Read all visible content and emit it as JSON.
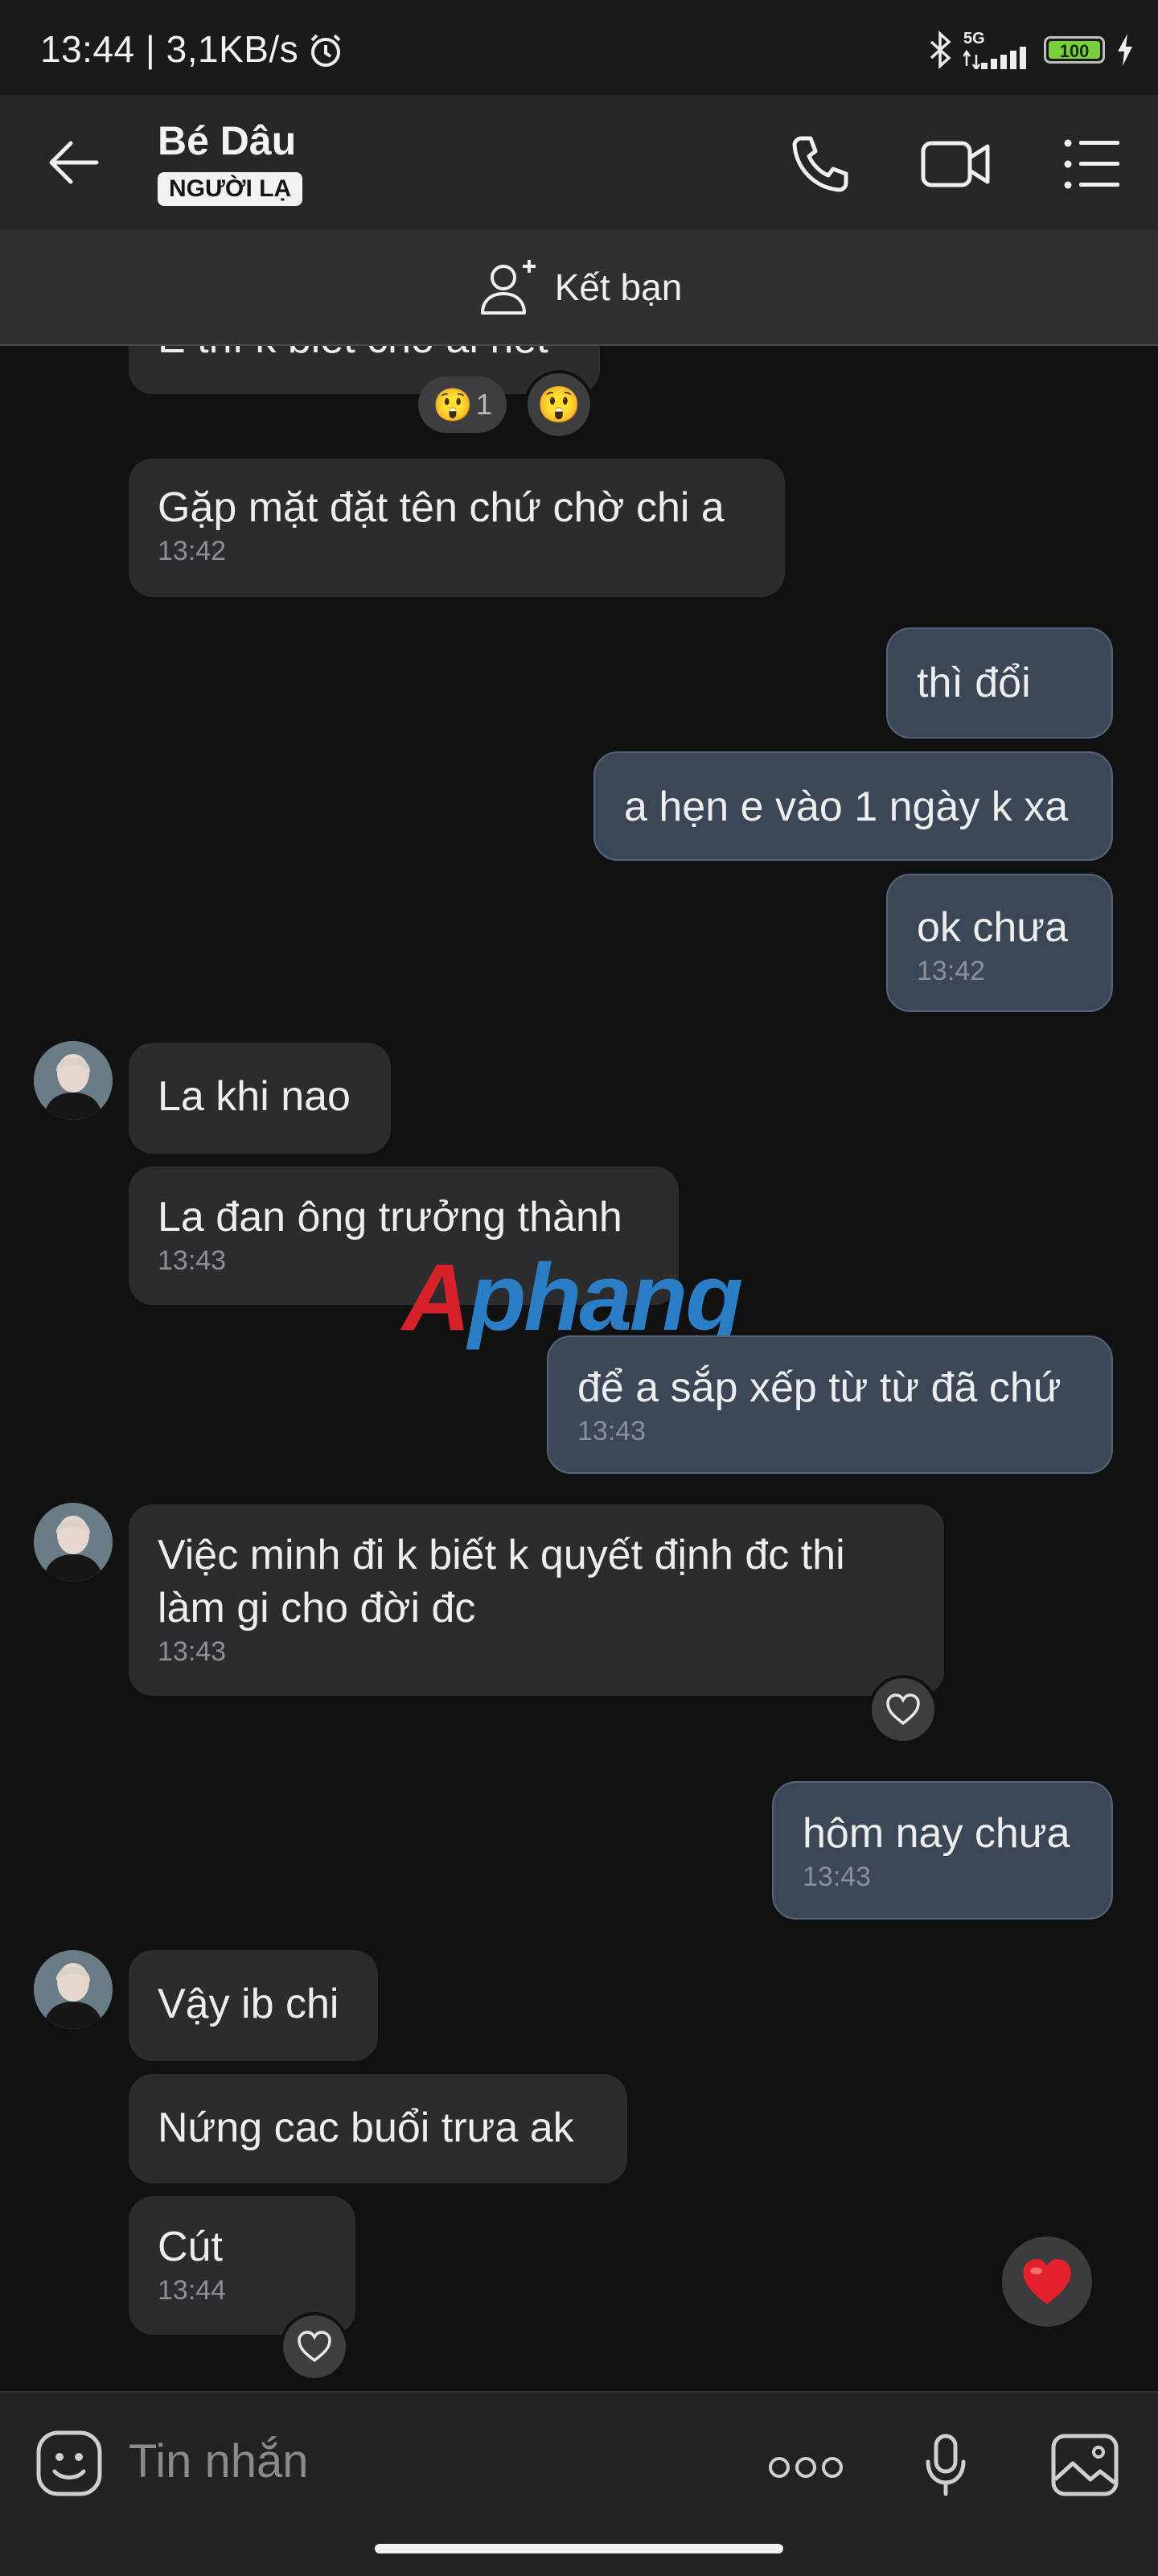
{
  "status_bar": {
    "time": "13:44 | 3,1KB/s",
    "network": "5G",
    "battery": "100"
  },
  "header": {
    "contact_name": "Bé Dâu",
    "badge": "NGƯỜI LẠ"
  },
  "add_friend": {
    "label": "Kết bạn"
  },
  "messages": [
    {
      "text": "E thì k biết cho ai hết",
      "reactions": [
        "1"
      ]
    },
    {
      "text": "Gặp mặt đặt tên chứ chờ chi a",
      "time": "13:42"
    },
    {
      "text": "thì đổi"
    },
    {
      "text": "a hẹn e vào 1 ngày k xa"
    },
    {
      "text": "ok chưa",
      "time": "13:42"
    },
    {
      "text": "La khi nao"
    },
    {
      "text": "La đan ông trưởng thành",
      "time": "13:43"
    },
    {
      "text": "để a sắp xếp từ từ đã chứ",
      "time": "13:43"
    },
    {
      "text": "Việc minh đi k biết k quyết định đc thi\nlàm gi cho đời đc",
      "time": "13:43"
    },
    {
      "text": "hôm nay chưa",
      "time": "13:43"
    },
    {
      "text": "Vậy ib chi"
    },
    {
      "text": "Nứng cac buổi trưa ak"
    },
    {
      "text": "Cút",
      "time": "13:44"
    }
  ],
  "watermark": {
    "text": "Aphang",
    "red": "#d6202a",
    "blue": "#2a7ec6"
  },
  "composer": {
    "placeholder": "Tin nhắn"
  },
  "colors": {
    "incoming_bubble": "#2c2c2e",
    "outgoing_bubble": "#3b4757",
    "background": "#111112"
  },
  "icons": [
    "back-icon",
    "phone-icon",
    "video-icon",
    "menu-icon",
    "add-user-icon",
    "heart-icon",
    "sticker-icon",
    "more-icon",
    "mic-icon",
    "image-icon"
  ]
}
